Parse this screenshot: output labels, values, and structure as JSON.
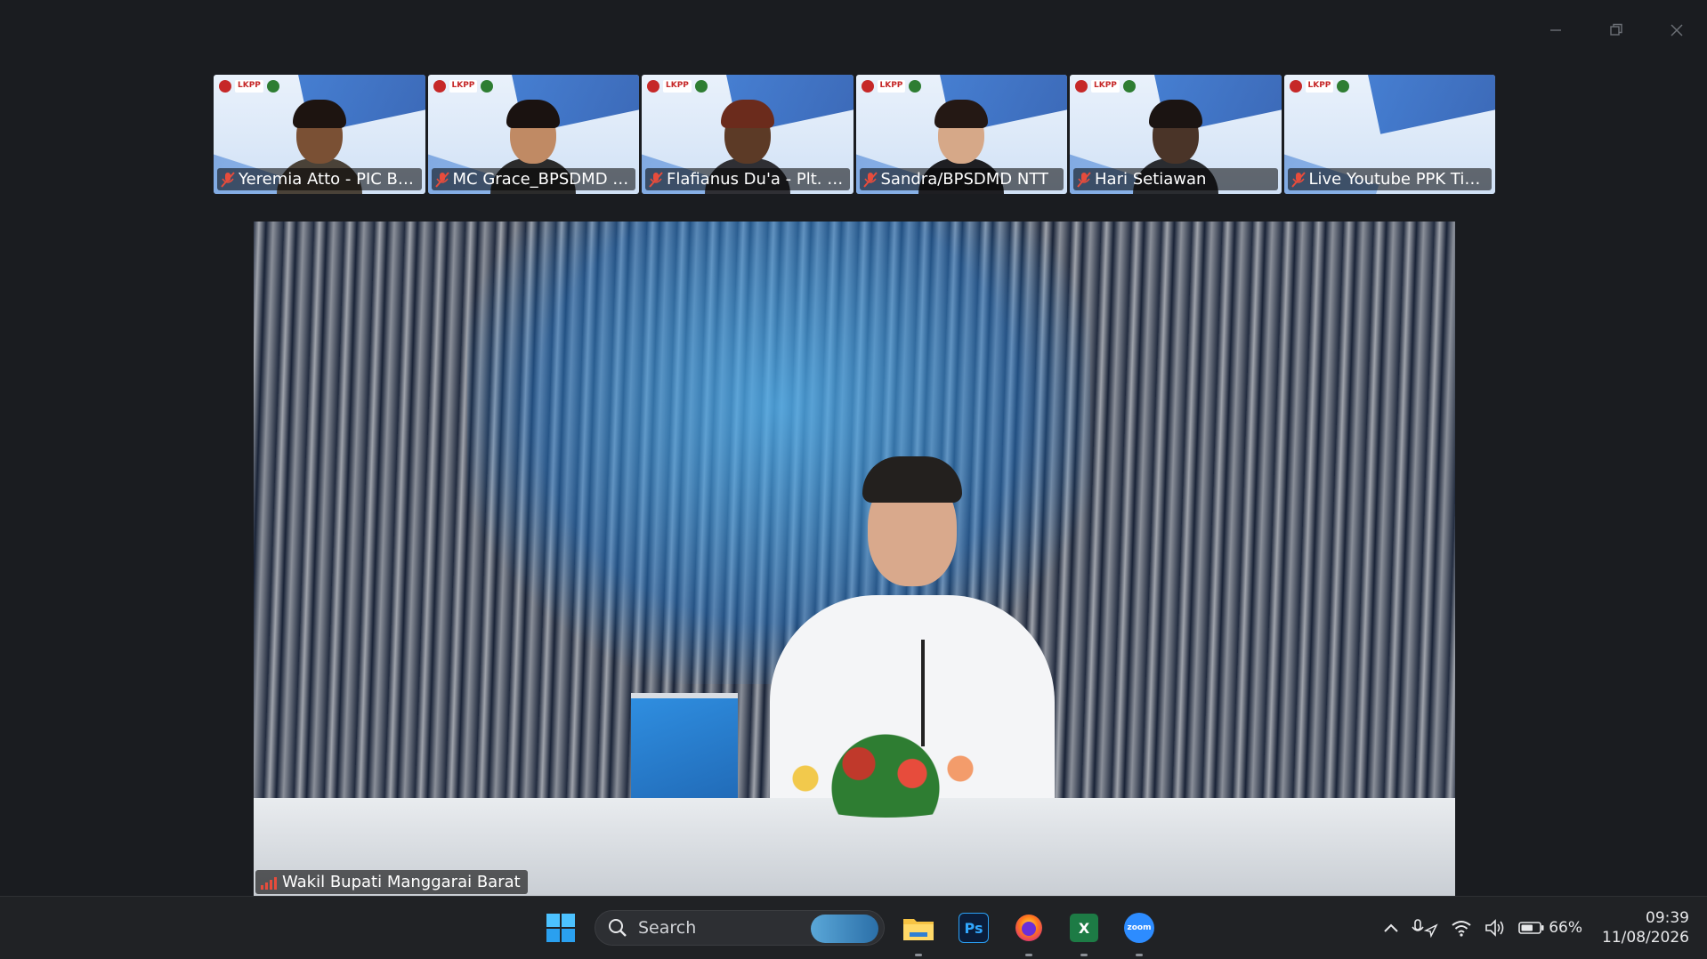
{
  "window": {
    "controls": {
      "minimize": "minimize",
      "restore": "restore",
      "close": "close"
    }
  },
  "participants": [
    {
      "name": "Yeremia Atto - PIC BPS...",
      "skin": "#7a5034",
      "hair": "#1d1410",
      "shirt": "#4a4238"
    },
    {
      "name": "MC Grace_BPSDMD N...",
      "skin": "#c08a64",
      "hair": "#1a1210",
      "shirt": "#2b2b2b"
    },
    {
      "name": "Flafianus Du'a - Plt. Ke...",
      "skin": "#5c3a26",
      "hair": "#6b2b1c",
      "shirt": "#2f2f34"
    },
    {
      "name": "Sandra/BPSDMD NTT",
      "skin": "#d6a888",
      "hair": "#241814",
      "shirt": "#1e1e22"
    },
    {
      "name": "Hari Setiawan",
      "skin": "#4a3428",
      "hair": "#1b1412",
      "shirt": "#2a2c30"
    },
    {
      "name": "Live Youtube PPK Tipe ...",
      "skin": "",
      "hair": "",
      "shirt": ""
    }
  ],
  "speaker": {
    "name": "Wakil Bupati Manggarai Barat"
  },
  "taskbar": {
    "search_placeholder": "Search",
    "apps": [
      "file-explorer",
      "photoshop",
      "firefox",
      "excel",
      "zoom"
    ],
    "ps_label": "Ps",
    "excel_label": "X",
    "zoom_label": "zoom"
  },
  "tray": {
    "battery": "66%",
    "time": "09:39",
    "date": "11/08/2026"
  },
  "colors": {
    "background": "#1a1c20",
    "taskbar": "#202225",
    "muted_mic": "#e74c3c"
  }
}
